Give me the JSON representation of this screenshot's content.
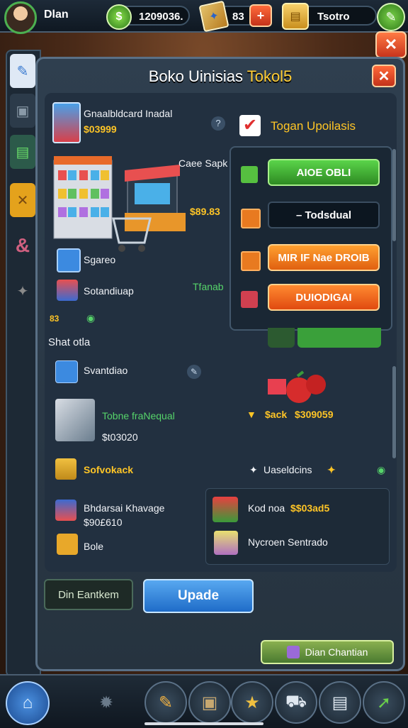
{
  "topbar": {
    "player_name": "Dlan",
    "cash": "1209036.",
    "gems": "83",
    "gems_plus": "+",
    "coins": "Tsotro"
  },
  "panel": {
    "title_main": "Boko Uinisias ",
    "title_accent": "Tokol5",
    "close": "✕"
  },
  "main": {
    "item1_label": "Gnaalbldcard Inadal",
    "item1_price": "$03999",
    "item2_label": "Caee Sapk",
    "item2_price": "$89.83",
    "item3_label": "Sgareo",
    "item4_label": "Sotandiuap",
    "item4_value": "Tfanab",
    "item5_value": "83",
    "section_heading": "Shat otla",
    "item6_label": "Svantdiao",
    "item7_label": "Tobne fraNequal",
    "item7_price": "$t03020",
    "item8_label": "$ack",
    "item8_price": "$309059",
    "item9_label": "Sofvokack",
    "item10_label": "Uaseldcins",
    "item11_label": "Bhdarsai Khavage",
    "item11_price": "$90£610",
    "item12_label": "Bole",
    "sub1_label": "Kod noa",
    "sub1_price": "$$03ad5",
    "sub2_label": "Nycroen Sentrado"
  },
  "popup": {
    "header_label": "Togan Upoilasis",
    "btn1": "AIOE OBLI",
    "btn2": "– Todsdual",
    "btn3": "MIR IF Nae DROIB",
    "btn4": "DUIODIGAI"
  },
  "footer": {
    "left_button": "Din Eantkem",
    "upgrade_button": "Upade",
    "secondary_button": "Dian Chantian"
  },
  "colors": {
    "accent_green": "#56d46a",
    "price_gold": "#ffc526",
    "close_red": "#d8401f",
    "upgrade_blue": "#2f86e0"
  }
}
